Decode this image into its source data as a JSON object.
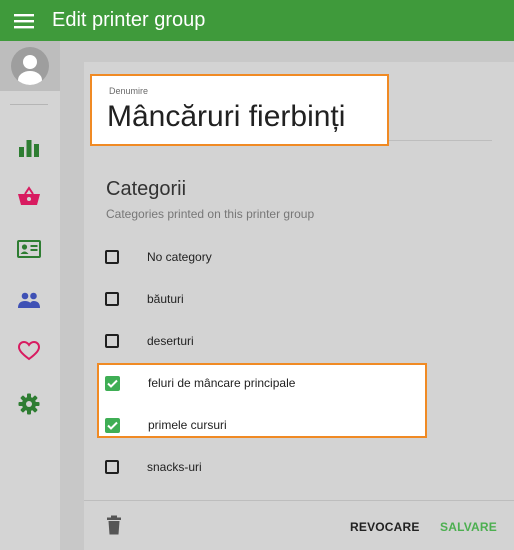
{
  "appbar": {
    "title": "Edit printer group"
  },
  "sidebar": {
    "items": [
      {
        "icon": "bar-chart-icon",
        "color": "#2e7d32"
      },
      {
        "icon": "basket-icon",
        "color": "#d81b60"
      },
      {
        "icon": "contact-card-icon",
        "color": "#2e7d32"
      },
      {
        "icon": "people-icon",
        "color": "#3f51b5"
      },
      {
        "icon": "heart-icon",
        "color": "#d81b60"
      },
      {
        "icon": "gear-icon",
        "color": "#2e7d32"
      }
    ]
  },
  "form": {
    "name_label": "Denumire",
    "name_value": "Mâncăruri fierbinți",
    "categories_title": "Categorii",
    "categories_subtitle": "Categories printed on this printer group",
    "categories": [
      {
        "label": "No category",
        "checked": false
      },
      {
        "label": "băuturi",
        "checked": false
      },
      {
        "label": "deserturi",
        "checked": false
      },
      {
        "label": "feluri de mâncare principale",
        "checked": true
      },
      {
        "label": "primele cursuri",
        "checked": true
      },
      {
        "label": "snacks-uri",
        "checked": false
      }
    ]
  },
  "footer": {
    "cancel_label": "REVOCARE",
    "save_label": "SALVARE"
  },
  "colors": {
    "appbar": "#3f9a3b",
    "checked": "#3fae55",
    "highlight": "#f08a24",
    "save": "#4caf50"
  }
}
